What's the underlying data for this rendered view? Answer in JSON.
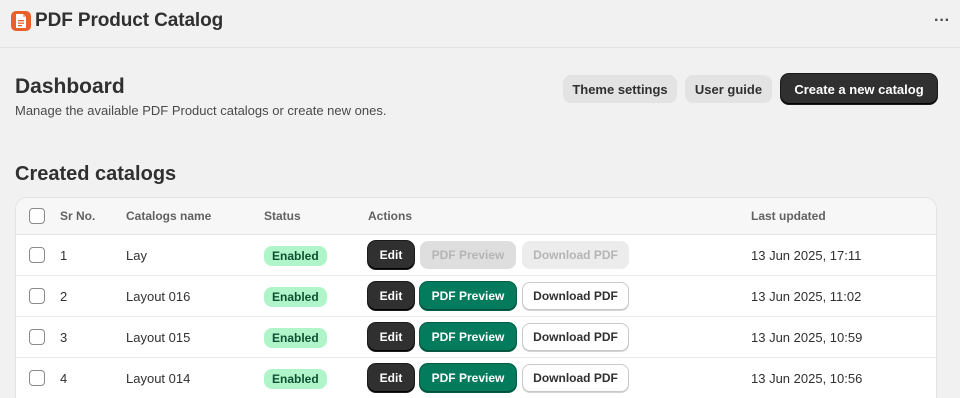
{
  "app": {
    "title": "PDF Product Catalog",
    "icon": "pdf-document-icon",
    "more_icon": "···"
  },
  "header": {
    "title": "Dashboard",
    "subtitle": "Manage the available PDF Product catalogs or create new ones.",
    "theme_settings_label": "Theme settings",
    "user_guide_label": "User guide",
    "create_label": "Create a new catalog"
  },
  "catalogs": {
    "section_title": "Created catalogs",
    "columns": {
      "sr_no": "Sr No.",
      "name": "Catalogs name",
      "status": "Status",
      "actions": "Actions",
      "last_updated": "Last updated"
    },
    "actions": {
      "edit": "Edit",
      "preview": "PDF Preview",
      "download": "Download PDF"
    },
    "rows": [
      {
        "sr": "1",
        "name": "Lay",
        "status": "Enabled",
        "updated": "13 Jun 2025, 17:11"
      },
      {
        "sr": "2",
        "name": "Layout 016",
        "status": "Enabled",
        "updated": "13 Jun 2025, 11:02"
      },
      {
        "sr": "3",
        "name": "Layout 015",
        "status": "Enabled",
        "updated": "13 Jun 2025, 10:59"
      },
      {
        "sr": "4",
        "name": "Layout 014",
        "status": "Enabled",
        "updated": "13 Jun 2025, 10:56"
      }
    ]
  },
  "colors": {
    "accent_orange": "#e8602c",
    "primary_dark": "#303030",
    "preview_green": "#047b5d",
    "badge_green_bg": "#aff5c9",
    "badge_green_text": "#0c5132"
  }
}
